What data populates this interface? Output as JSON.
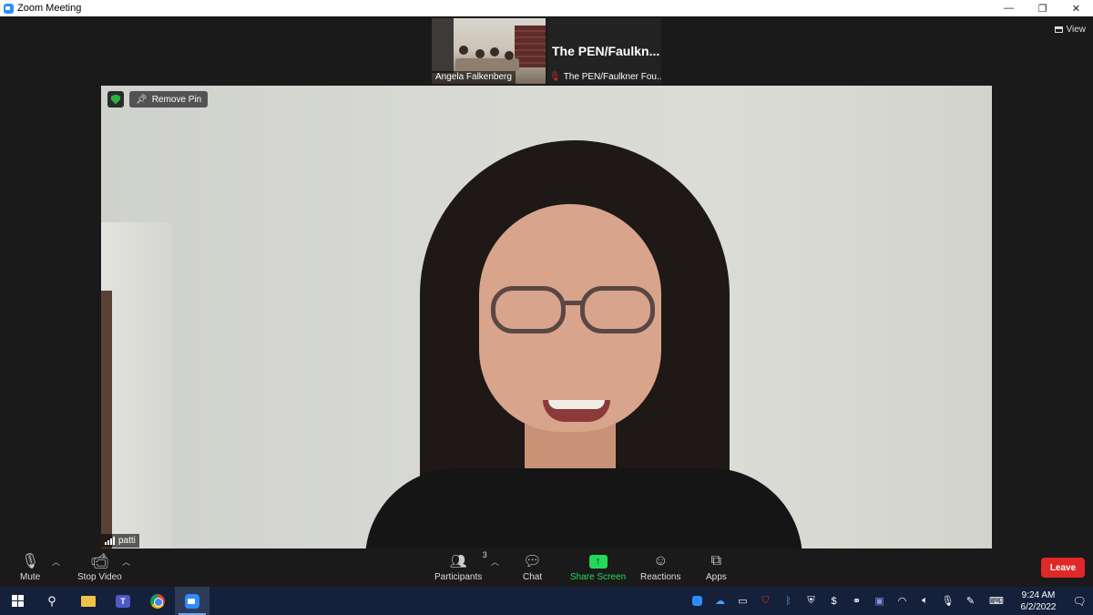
{
  "window": {
    "title": "Zoom Meeting",
    "minimize": "—",
    "restore": "❐",
    "close": "✕"
  },
  "view_button": {
    "label": "View"
  },
  "thumbnails": [
    {
      "name": "Angela Falkenberg"
    },
    {
      "big_name": "The  PEN/Faulkn...",
      "name": "The PEN/Faulkner Fou..."
    }
  ],
  "main_video": {
    "remove_pin_label": "Remove Pin",
    "participant_name": "patti"
  },
  "toolbar": {
    "mute_label": "Mute",
    "stop_video_label": "Stop Video",
    "participants_label": "Participants",
    "participants_count": "3",
    "chat_label": "Chat",
    "share_screen_label": "Share Screen",
    "reactions_label": "Reactions",
    "apps_label": "Apps",
    "leave_label": "Leave"
  },
  "taskbar": {
    "time": "9:24 AM",
    "date": "6/2/2022"
  },
  "colors": {
    "accent_blue": "#2d8cff",
    "share_green": "#23d959",
    "leave_red": "#e02828",
    "security_green": "#2bb140",
    "taskbar_bg": "#15203a"
  }
}
